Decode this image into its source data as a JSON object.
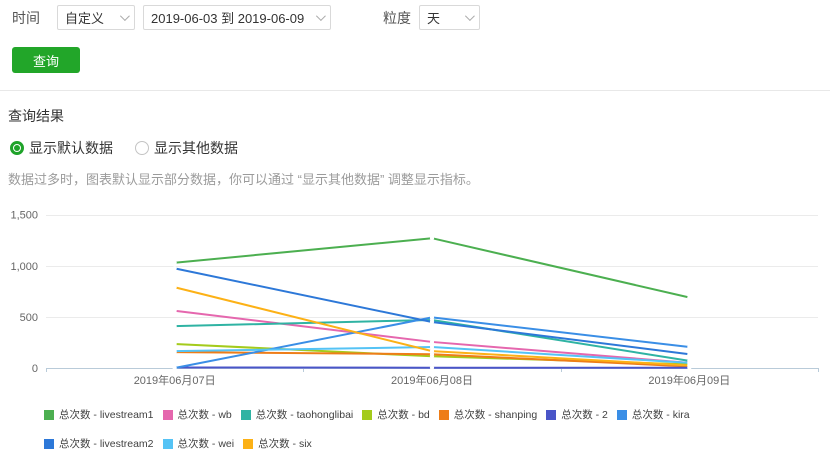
{
  "filters": {
    "time_label": "时间",
    "time_preset_value": "自定义",
    "date_range_value": "2019-06-03 到 2019-06-09",
    "granularity_label": "粒度",
    "granularity_value": "天",
    "query_button_label": "查询"
  },
  "results": {
    "section_title": "查询结果",
    "radio_default_label": "显示默认数据",
    "radio_other_label": "显示其他数据",
    "radio_selected": "default",
    "hint": "数据过多时，图表默认显示部分数据，你可以通过 “显示其他数据” 调整显示指标。"
  },
  "chart_data": {
    "type": "line",
    "title": "",
    "xlabel": "",
    "ylabel": "",
    "categories": [
      "2019年06月07日",
      "2019年06月08日",
      "2019年06月09日"
    ],
    "ylim": [
      0,
      1500
    ],
    "y_ticks": [
      0,
      500,
      1000,
      1500
    ],
    "y_tick_labels": [
      "0",
      "500",
      "1,000",
      "1,500"
    ],
    "grid": true,
    "legend_position": "bottom",
    "series": [
      {
        "name": "总次数 - livestream1",
        "color": "#4caf50",
        "values": [
          1030,
          1270,
          690
        ]
      },
      {
        "name": "总次数 - wb",
        "color": "#e567ae",
        "values": [
          560,
          255,
          50
        ]
      },
      {
        "name": "总次数 - taohonglibai",
        "color": "#2fb3a3",
        "values": [
          410,
          470,
          70
        ]
      },
      {
        "name": "总次数 - bd",
        "color": "#a4cb1c",
        "values": [
          235,
          115,
          35
        ]
      },
      {
        "name": "总次数 - shanping",
        "color": "#ee7d18",
        "values": [
          155,
          135,
          15
        ]
      },
      {
        "name": "总次数 - 2",
        "color": "#4a55c8",
        "values": [
          5,
          3,
          3
        ]
      },
      {
        "name": "总次数 - kira",
        "color": "#3a8ee6",
        "values": [
          0,
          495,
          205
        ]
      },
      {
        "name": "总次数 - livestream2",
        "color": "#2d78d8",
        "values": [
          975,
          450,
          135
        ]
      },
      {
        "name": "总次数 - wei",
        "color": "#55c3f5",
        "values": [
          165,
          205,
          50
        ]
      },
      {
        "name": "总次数 - six",
        "color": "#fcb116",
        "values": [
          790,
          165,
          25
        ]
      }
    ]
  },
  "chart_style": {
    "axis_color": "#b9cbd9",
    "grid_color": "#ebebeb",
    "tick_label_color": "#666666"
  }
}
